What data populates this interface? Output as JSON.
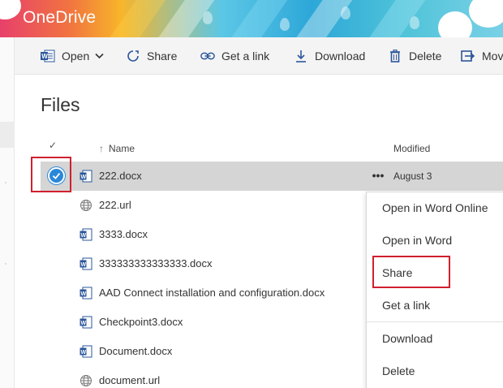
{
  "app": {
    "brand": "OneDrive"
  },
  "colors": {
    "accent": "#2b88d8",
    "word_icon": "#2b579a",
    "highlight": "#d0202e",
    "selected_row": "#d5d5d5"
  },
  "commands": [
    {
      "label": "Open",
      "icon": "word-icon",
      "has_dropdown": true
    },
    {
      "label": "Share",
      "icon": "share-icon"
    },
    {
      "label": "Get a link",
      "icon": "link-icon"
    },
    {
      "label": "Download",
      "icon": "download-icon"
    },
    {
      "label": "Delete",
      "icon": "trash-icon"
    },
    {
      "label": "Mov",
      "icon": "move-icon"
    }
  ],
  "page": {
    "title": "Files"
  },
  "columns": {
    "check": "✓",
    "name": "Name",
    "modified": "Modified"
  },
  "files": [
    {
      "name": "222.docx",
      "type": "word",
      "modified": "August 3",
      "selected": true,
      "more": "•••"
    },
    {
      "name": "222.url",
      "type": "url",
      "modified": ""
    },
    {
      "name": "3333.docx",
      "type": "word",
      "modified": ""
    },
    {
      "name": "333333333333333.docx",
      "type": "word",
      "modified": ""
    },
    {
      "name": "AAD Connect installation and configuration.docx",
      "type": "word",
      "modified": ""
    },
    {
      "name": "Checkpoint3.docx",
      "type": "word",
      "modified": ""
    },
    {
      "name": "Document.docx",
      "type": "word",
      "modified": ""
    },
    {
      "name": "document.url",
      "type": "url",
      "modified": ""
    }
  ],
  "context_menu": {
    "items": [
      {
        "label": "Open in Word Online"
      },
      {
        "label": "Open in Word"
      },
      {
        "label": "Share",
        "highlighted": true
      },
      {
        "label": "Get a link"
      },
      {
        "label": "Download"
      },
      {
        "label": "Delete"
      }
    ]
  }
}
